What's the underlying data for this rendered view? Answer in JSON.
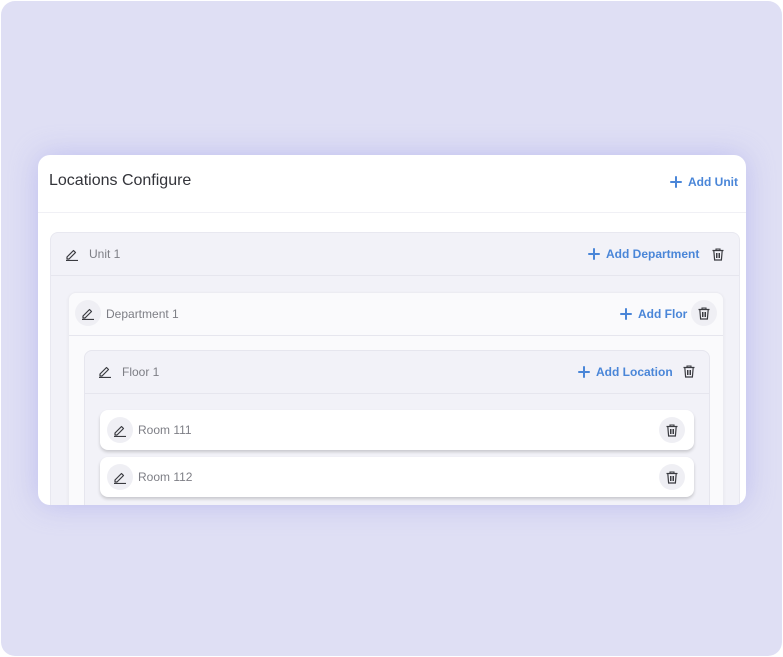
{
  "page": {
    "title": "Locations Configure",
    "add_unit_label": "Add Unit"
  },
  "unit": {
    "name": "Unit 1",
    "add_label": "Add Department"
  },
  "department": {
    "name": "Department 1",
    "add_label": "Add Flor"
  },
  "floor": {
    "name": "Floor 1",
    "add_label": "Add Location"
  },
  "rooms": [
    {
      "name": "Room 111"
    },
    {
      "name": "Room 112"
    }
  ],
  "colors": {
    "accent": "#4a86d8",
    "background": "#dfdff4",
    "text": "#33343a",
    "muted": "#7d7e85"
  },
  "icons": {
    "edit": "pencil-icon",
    "delete": "trash-icon",
    "add": "plus-icon"
  }
}
